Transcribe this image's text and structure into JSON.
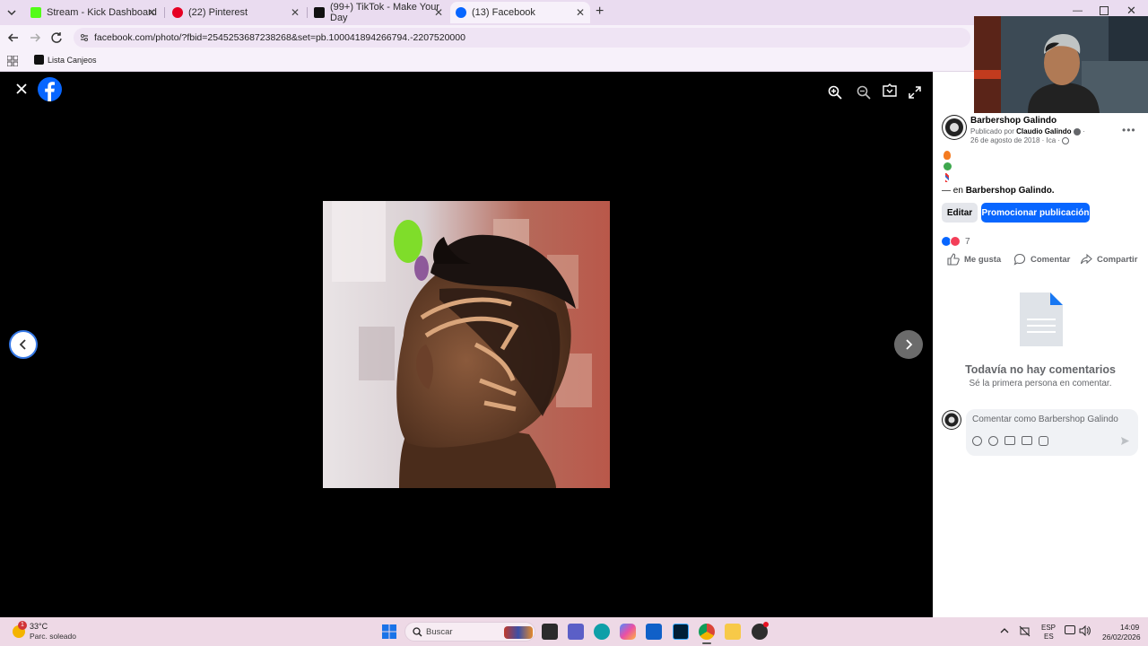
{
  "browser": {
    "tabs": [
      {
        "title": "Stream - Kick Dashboard",
        "icon": "kick-icon",
        "color": "#53fc18"
      },
      {
        "title": "(22) Pinterest",
        "icon": "pinterest-icon",
        "color": "#e60023"
      },
      {
        "title": "(99+) TikTok - Make Your Day",
        "icon": "tiktok-icon",
        "color": "#000000"
      },
      {
        "title": "(13) Facebook",
        "icon": "facebook-icon",
        "color": "#0866ff"
      }
    ],
    "url": "facebook.com/photo/?fbid=2545253687238268&set=pb.100041894266794.-2207520000",
    "bookmark": "Lista Canjeos"
  },
  "post": {
    "page_name": "Barbershop Galindo",
    "published_by_prefix": "Publicado por",
    "published_by": "Claudio Galindo",
    "date": "26 de agosto de 2018",
    "location": "Ica",
    "tag_prefix": "— en",
    "tag_name": "Barbershop Galindo.",
    "edit_label": "Editar",
    "promote_label": "Promocionar publicación",
    "reaction_count": "7",
    "like_label": "Me gusta",
    "comment_label": "Comentar",
    "share_label": "Compartir",
    "no_comments_title": "Todavía no hay comentarios",
    "no_comments_sub": "Sé la primera persona en comentar.",
    "comment_placeholder": "Comentar como Barbershop Galindo"
  },
  "taskbar": {
    "temperature": "33°C",
    "weather": "Parc. soleado",
    "weather_badge": "1",
    "search_placeholder": "Buscar",
    "lang1": "ESP",
    "lang2": "ES",
    "time": "14:09",
    "date": "26/02/2026"
  },
  "colors": {
    "facebook_blue": "#0866ff",
    "tabbar_bg": "#eadcf0",
    "taskbar_bg": "#eed9e6"
  }
}
